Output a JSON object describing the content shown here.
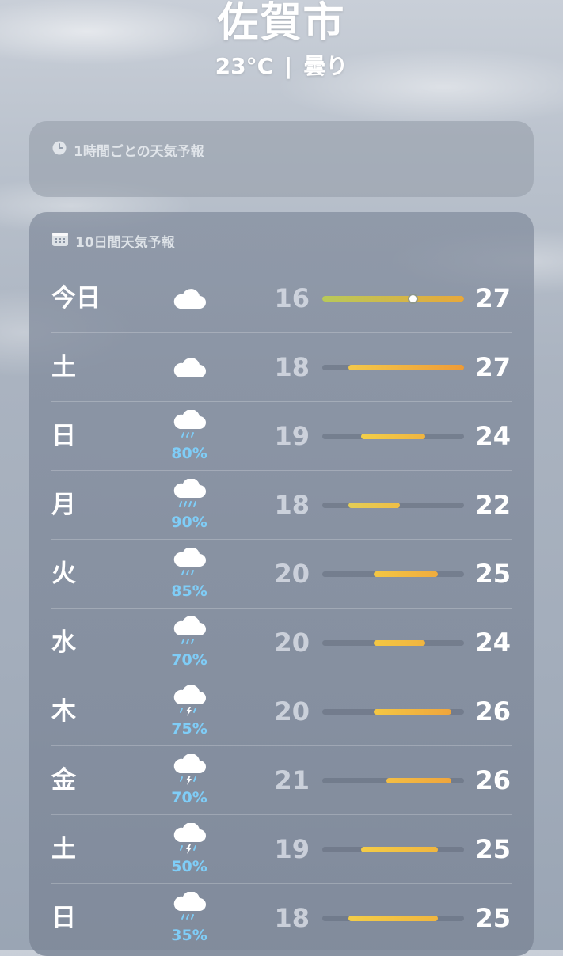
{
  "location": {
    "city": "佐賀市",
    "temperature": "23°C",
    "separator": "|",
    "condition": "曇り"
  },
  "hourly": {
    "title": "1時間ごとの天気予報",
    "icon": "clock-icon"
  },
  "daily": {
    "title": "10日間天気予報",
    "icon": "calendar-icon",
    "range_min": 16,
    "range_max": 27,
    "current_temp": 23,
    "days": [
      {
        "day": "今日",
        "icon": "cloud-icon",
        "precip": "",
        "low": "16",
        "high": "27",
        "low_n": 16,
        "high_n": 27,
        "colors": [
          "#b8c95a",
          "#e8a83a"
        ]
      },
      {
        "day": "土",
        "icon": "cloud-icon",
        "precip": "",
        "low": "18",
        "high": "27",
        "low_n": 18,
        "high_n": 27,
        "colors": [
          "#f3c84a",
          "#ef9b36"
        ]
      },
      {
        "day": "日",
        "icon": "cloud-rain-icon",
        "precip": "80%",
        "low": "19",
        "high": "24",
        "low_n": 19,
        "high_n": 24,
        "colors": [
          "#f2cf48",
          "#f0b440"
        ]
      },
      {
        "day": "月",
        "icon": "cloud-heavy-rain-icon",
        "precip": "90%",
        "low": "18",
        "high": "22",
        "low_n": 18,
        "high_n": 22,
        "colors": [
          "#e3cd56",
          "#efbe46"
        ]
      },
      {
        "day": "火",
        "icon": "cloud-rain-icon",
        "precip": "85%",
        "low": "20",
        "high": "25",
        "low_n": 20,
        "high_n": 25,
        "colors": [
          "#f4c743",
          "#f0ac3e"
        ]
      },
      {
        "day": "水",
        "icon": "cloud-rain-icon",
        "precip": "70%",
        "low": "20",
        "high": "24",
        "low_n": 20,
        "high_n": 24,
        "colors": [
          "#f4c743",
          "#f0b440"
        ]
      },
      {
        "day": "木",
        "icon": "cloud-thunder-icon",
        "precip": "75%",
        "low": "20",
        "high": "26",
        "low_n": 20,
        "high_n": 26,
        "colors": [
          "#f4c743",
          "#efa53c"
        ]
      },
      {
        "day": "金",
        "icon": "cloud-thunder-icon",
        "precip": "70%",
        "low": "21",
        "high": "26",
        "low_n": 21,
        "high_n": 26,
        "colors": [
          "#f3be44",
          "#efa53c"
        ]
      },
      {
        "day": "土",
        "icon": "cloud-thunder-icon",
        "precip": "50%",
        "low": "19",
        "high": "25",
        "low_n": 19,
        "high_n": 25,
        "colors": [
          "#f4cc46",
          "#f0b63f"
        ]
      },
      {
        "day": "日",
        "icon": "cloud-rain-icon",
        "precip": "35%",
        "low": "18",
        "high": "25",
        "low_n": 18,
        "high_n": 25,
        "colors": [
          "#f3cd48",
          "#f0b63f"
        ]
      }
    ]
  }
}
